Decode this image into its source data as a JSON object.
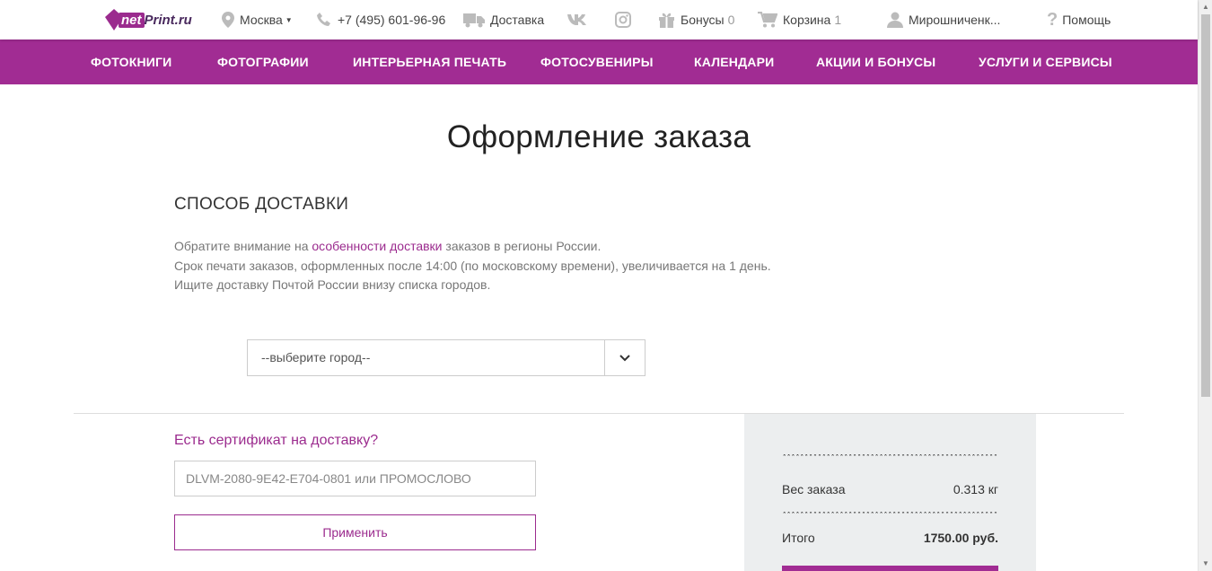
{
  "logo": {
    "net": "net",
    "rest": "Print.ru"
  },
  "topbar": {
    "city": "Москва",
    "phone": "+7 (495) 601-96-96",
    "delivery": "Доставка",
    "bonus_label": "Бонусы",
    "bonus_count": "0",
    "cart_label": "Корзина",
    "cart_count": "1",
    "user": "Мирошниченк...",
    "help": "Помощь"
  },
  "nav": {
    "items": [
      "ФОТОКНИГИ",
      "ФОТОГРАФИИ",
      "ИНТЕРЬЕРНАЯ ПЕЧАТЬ",
      "ФОТОСУВЕНИРЫ",
      "КАЛЕНДАРИ",
      "АКЦИИ И БОНУСЫ",
      "УСЛУГИ И СЕРВИСЫ"
    ]
  },
  "page": {
    "title": "Оформление заказа",
    "section_title": "СПОСОБ ДОСТАВКИ",
    "notice_1_pre": "Обратите внимание на ",
    "notice_1_link": "особенности доставки",
    "notice_1_post": " заказов в регионы России.",
    "notice_2": "Срок печати заказов, оформленных после 14:00 (по московскому времени), увеличивается на 1 день.",
    "notice_3": "Ищите доставку Почтой России внизу списка городов."
  },
  "city_select": {
    "value": "--выберите город--"
  },
  "certificate": {
    "title": "Есть сертификат на доставку?",
    "placeholder": "DLVM-2080-9E42-E704-0801 или ПРОМОСЛОВО",
    "apply_label": "Применить"
  },
  "summary": {
    "separator": "******************************************************************",
    "weight_label": "Вес заказа",
    "weight_value": "0.313 кг",
    "total_label": "Итого",
    "total_value": "1750.00 руб."
  },
  "colors": {
    "brand": "#a12c93",
    "link": "#9b2b8e"
  }
}
